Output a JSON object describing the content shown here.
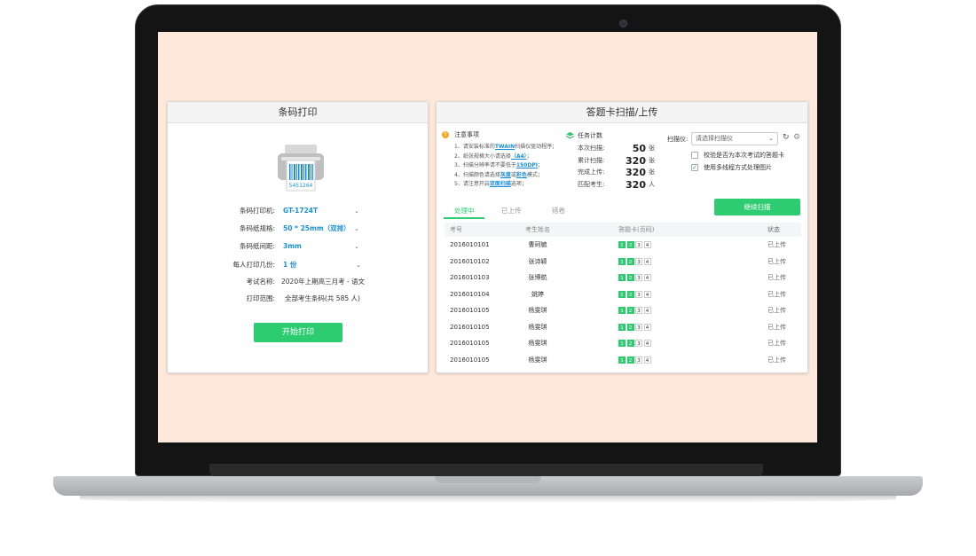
{
  "colors": {
    "accent_green": "#2ecc71",
    "link_blue": "#1a8fd8",
    "screen_bg": "#fde8d9",
    "warning_orange": "#f5a623"
  },
  "barcode_panel": {
    "title": "条码打印",
    "barcode_number": "5451264",
    "fields": [
      {
        "label": "条码打印机:",
        "value": "GT-1724T"
      },
      {
        "label": "条码纸规格:",
        "value": "50 * 25mm（双排）"
      },
      {
        "label": "条码纸间距:",
        "value": "3mm"
      },
      {
        "label": "每人打印几份:",
        "value": "1 份"
      },
      {
        "label": "考试名称:",
        "value": "2020年上期高三月考 - 语文"
      },
      {
        "label": "打印范围:",
        "value": "全部考生条码(共 585 人)"
      }
    ],
    "start_button": "开始打印"
  },
  "scan_panel": {
    "title": "答题卡扫描/上传",
    "notes": {
      "title": "注意事项",
      "lines": [
        {
          "pre": "1、请安装标准的",
          "hl": "TWAIN",
          "post": "扫描仪驱动程序；"
        },
        {
          "pre": "2、纸张规格大小请选择",
          "hl": "（A4）",
          "post": "；"
        },
        {
          "pre": "3、扫描分辨率请不要低于",
          "hl": "150DPI",
          "post": "；"
        },
        {
          "pre": "4、扫描颜色请选择",
          "hl": "灰度",
          "mid": "或",
          "hl2": "彩色",
          "post": "模式；"
        },
        {
          "pre": "5、请注意开启",
          "hl": "双面扫描",
          "post": "选项；"
        }
      ]
    },
    "task": {
      "title": "任务计数",
      "rows": [
        {
          "label": "本次扫描:",
          "num": "50",
          "unit": "张"
        },
        {
          "label": "累计扫描:",
          "num": "320",
          "unit": "张"
        },
        {
          "label": "完成上传:",
          "num": "320",
          "unit": "张"
        },
        {
          "label": "匹配考生:",
          "num": "320",
          "unit": "人"
        }
      ]
    },
    "scanner": {
      "label": "扫描仪:",
      "placeholder": "请选择扫描仪",
      "checks": [
        {
          "label": "校验是否为本次考试的答题卡",
          "checked": false
        },
        {
          "label": "使用多线程方式处理图片",
          "checked": true
        }
      ]
    },
    "tabs": [
      {
        "label": "处理中"
      },
      {
        "label": "已上传"
      },
      {
        "label": "错卷"
      }
    ],
    "continue_button": "继续扫描",
    "table": {
      "headers": [
        "考号",
        "考生姓名",
        "答题卡(页码)",
        "状态"
      ],
      "pages": [
        "1",
        "2",
        "3",
        "4"
      ],
      "rows": [
        {
          "id": "2016010101",
          "name": "曹珂毓",
          "status": "已上传"
        },
        {
          "id": "2016010102",
          "name": "张诗颖",
          "status": "已上传"
        },
        {
          "id": "2016010103",
          "name": "张博航",
          "status": "已上传"
        },
        {
          "id": "2016010104",
          "name": "姚婷",
          "status": "已上传"
        },
        {
          "id": "2016010105",
          "name": "杨雯琪",
          "status": "已上传"
        },
        {
          "id": "2016010105",
          "name": "杨雯琪",
          "status": "已上传"
        },
        {
          "id": "2016010105",
          "name": "杨雯琪",
          "status": "已上传"
        },
        {
          "id": "2016010105",
          "name": "杨雯琪",
          "status": "已上传"
        }
      ]
    }
  }
}
